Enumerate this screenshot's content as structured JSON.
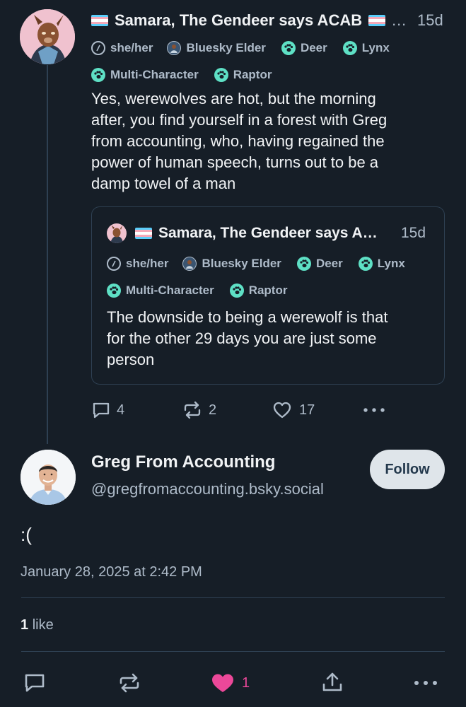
{
  "parent_post": {
    "author_name": "Samara, The Gendeer says ACAB",
    "ellipsis": "…",
    "time": "15d",
    "badges": {
      "pronouns": "she/her",
      "elder": "Bluesky Elder",
      "deer": "Deer",
      "lynx": "Lynx",
      "multi": "Multi-Character",
      "raptor": "Raptor"
    },
    "text": "Yes, werewolves are hot, but the morning after, you find yourself in a forest with Greg from accounting, who, having regained the power of human speech, turns out to be a damp towel of a man",
    "text_lines": [
      "Yes, werewolves are hot, but the morning",
      "after, you find yourself in a forest with Greg",
      "from accounting, who, having regained the",
      "power of human speech, turns out to be a",
      "damp towel of a man"
    ],
    "quote": {
      "author_name": "Samara, The Gendeer says A…",
      "time": "15d",
      "badges": {
        "pronouns": "she/her",
        "elder": "Bluesky Elder",
        "deer": "Deer",
        "lynx": "Lynx",
        "multi": "Multi-Character",
        "raptor": "Raptor"
      },
      "text_lines": [
        "The downside to being a werewolf is that",
        "for the other 29 days you are just some",
        "person"
      ]
    },
    "stats": {
      "replies": "4",
      "reposts": "2",
      "likes": "17"
    }
  },
  "main_post": {
    "author_name": "Greg From Accounting",
    "handle": "@gregfromaccounting.bsky.social",
    "follow_label": "Follow",
    "text": ":(",
    "timestamp": "January 28, 2025 at 2:42 PM",
    "likes_count": "1",
    "likes_label": "like",
    "liked_count_action": "1"
  },
  "icons": {
    "reply": "reply-icon",
    "repost": "repost-icon",
    "like": "heart-icon",
    "more": "more-icon",
    "share": "share-icon",
    "pronoun": "pronoun-badge-icon",
    "paw": "paw-icon",
    "trans_flag": "trans-flag-icon"
  },
  "colors": {
    "background": "#161e27",
    "text_primary": "#f1f3f5",
    "text_secondary": "#aebbc9",
    "accent_teal": "#5ee0c5",
    "like_pink": "#ec4899",
    "border": "#2e4052",
    "follow_bg": "#dfe5ea",
    "follow_text": "#23384c"
  }
}
